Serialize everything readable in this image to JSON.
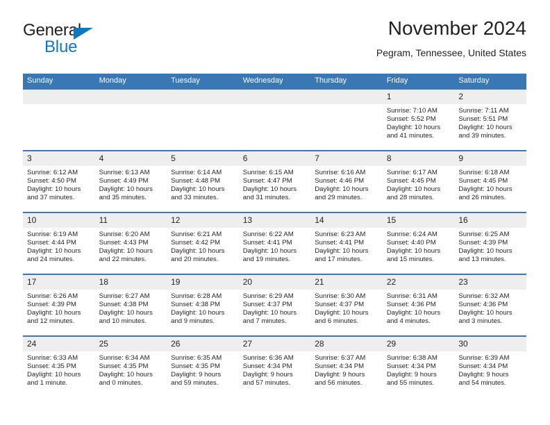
{
  "brand": {
    "name_part1": "General",
    "name_part2": "Blue",
    "accent_color": "#1277bd"
  },
  "header": {
    "title": "November 2024",
    "subtitle": "Pegram, Tennessee, United States"
  },
  "theme": {
    "header_blue": "#3a77b5",
    "daynum_band": "#eeeeee",
    "text": "#231f20"
  },
  "calendar": {
    "weekday_headers": [
      "Sunday",
      "Monday",
      "Tuesday",
      "Wednesday",
      "Thursday",
      "Friday",
      "Saturday"
    ],
    "labels": {
      "sunrise": "Sunrise:",
      "sunset": "Sunset:",
      "daylight": "Daylight:"
    },
    "weeks": [
      [
        {
          "day": "",
          "sunrise": "",
          "sunset": "",
          "daylight_line1": "",
          "daylight_line2": ""
        },
        {
          "day": "",
          "sunrise": "",
          "sunset": "",
          "daylight_line1": "",
          "daylight_line2": ""
        },
        {
          "day": "",
          "sunrise": "",
          "sunset": "",
          "daylight_line1": "",
          "daylight_line2": ""
        },
        {
          "day": "",
          "sunrise": "",
          "sunset": "",
          "daylight_line1": "",
          "daylight_line2": ""
        },
        {
          "day": "",
          "sunrise": "",
          "sunset": "",
          "daylight_line1": "",
          "daylight_line2": ""
        },
        {
          "day": "1",
          "sunrise": "Sunrise: 7:10 AM",
          "sunset": "Sunset: 5:52 PM",
          "daylight_line1": "Daylight: 10 hours",
          "daylight_line2": "and 41 minutes."
        },
        {
          "day": "2",
          "sunrise": "Sunrise: 7:11 AM",
          "sunset": "Sunset: 5:51 PM",
          "daylight_line1": "Daylight: 10 hours",
          "daylight_line2": "and 39 minutes."
        }
      ],
      [
        {
          "day": "3",
          "sunrise": "Sunrise: 6:12 AM",
          "sunset": "Sunset: 4:50 PM",
          "daylight_line1": "Daylight: 10 hours",
          "daylight_line2": "and 37 minutes."
        },
        {
          "day": "4",
          "sunrise": "Sunrise: 6:13 AM",
          "sunset": "Sunset: 4:49 PM",
          "daylight_line1": "Daylight: 10 hours",
          "daylight_line2": "and 35 minutes."
        },
        {
          "day": "5",
          "sunrise": "Sunrise: 6:14 AM",
          "sunset": "Sunset: 4:48 PM",
          "daylight_line1": "Daylight: 10 hours",
          "daylight_line2": "and 33 minutes."
        },
        {
          "day": "6",
          "sunrise": "Sunrise: 6:15 AM",
          "sunset": "Sunset: 4:47 PM",
          "daylight_line1": "Daylight: 10 hours",
          "daylight_line2": "and 31 minutes."
        },
        {
          "day": "7",
          "sunrise": "Sunrise: 6:16 AM",
          "sunset": "Sunset: 4:46 PM",
          "daylight_line1": "Daylight: 10 hours",
          "daylight_line2": "and 29 minutes."
        },
        {
          "day": "8",
          "sunrise": "Sunrise: 6:17 AM",
          "sunset": "Sunset: 4:45 PM",
          "daylight_line1": "Daylight: 10 hours",
          "daylight_line2": "and 28 minutes."
        },
        {
          "day": "9",
          "sunrise": "Sunrise: 6:18 AM",
          "sunset": "Sunset: 4:45 PM",
          "daylight_line1": "Daylight: 10 hours",
          "daylight_line2": "and 26 minutes."
        }
      ],
      [
        {
          "day": "10",
          "sunrise": "Sunrise: 6:19 AM",
          "sunset": "Sunset: 4:44 PM",
          "daylight_line1": "Daylight: 10 hours",
          "daylight_line2": "and 24 minutes."
        },
        {
          "day": "11",
          "sunrise": "Sunrise: 6:20 AM",
          "sunset": "Sunset: 4:43 PM",
          "daylight_line1": "Daylight: 10 hours",
          "daylight_line2": "and 22 minutes."
        },
        {
          "day": "12",
          "sunrise": "Sunrise: 6:21 AM",
          "sunset": "Sunset: 4:42 PM",
          "daylight_line1": "Daylight: 10 hours",
          "daylight_line2": "and 20 minutes."
        },
        {
          "day": "13",
          "sunrise": "Sunrise: 6:22 AM",
          "sunset": "Sunset: 4:41 PM",
          "daylight_line1": "Daylight: 10 hours",
          "daylight_line2": "and 19 minutes."
        },
        {
          "day": "14",
          "sunrise": "Sunrise: 6:23 AM",
          "sunset": "Sunset: 4:41 PM",
          "daylight_line1": "Daylight: 10 hours",
          "daylight_line2": "and 17 minutes."
        },
        {
          "day": "15",
          "sunrise": "Sunrise: 6:24 AM",
          "sunset": "Sunset: 4:40 PM",
          "daylight_line1": "Daylight: 10 hours",
          "daylight_line2": "and 15 minutes."
        },
        {
          "day": "16",
          "sunrise": "Sunrise: 6:25 AM",
          "sunset": "Sunset: 4:39 PM",
          "daylight_line1": "Daylight: 10 hours",
          "daylight_line2": "and 13 minutes."
        }
      ],
      [
        {
          "day": "17",
          "sunrise": "Sunrise: 6:26 AM",
          "sunset": "Sunset: 4:39 PM",
          "daylight_line1": "Daylight: 10 hours",
          "daylight_line2": "and 12 minutes."
        },
        {
          "day": "18",
          "sunrise": "Sunrise: 6:27 AM",
          "sunset": "Sunset: 4:38 PM",
          "daylight_line1": "Daylight: 10 hours",
          "daylight_line2": "and 10 minutes."
        },
        {
          "day": "19",
          "sunrise": "Sunrise: 6:28 AM",
          "sunset": "Sunset: 4:38 PM",
          "daylight_line1": "Daylight: 10 hours",
          "daylight_line2": "and 9 minutes."
        },
        {
          "day": "20",
          "sunrise": "Sunrise: 6:29 AM",
          "sunset": "Sunset: 4:37 PM",
          "daylight_line1": "Daylight: 10 hours",
          "daylight_line2": "and 7 minutes."
        },
        {
          "day": "21",
          "sunrise": "Sunrise: 6:30 AM",
          "sunset": "Sunset: 4:37 PM",
          "daylight_line1": "Daylight: 10 hours",
          "daylight_line2": "and 6 minutes."
        },
        {
          "day": "22",
          "sunrise": "Sunrise: 6:31 AM",
          "sunset": "Sunset: 4:36 PM",
          "daylight_line1": "Daylight: 10 hours",
          "daylight_line2": "and 4 minutes."
        },
        {
          "day": "23",
          "sunrise": "Sunrise: 6:32 AM",
          "sunset": "Sunset: 4:36 PM",
          "daylight_line1": "Daylight: 10 hours",
          "daylight_line2": "and 3 minutes."
        }
      ],
      [
        {
          "day": "24",
          "sunrise": "Sunrise: 6:33 AM",
          "sunset": "Sunset: 4:35 PM",
          "daylight_line1": "Daylight: 10 hours",
          "daylight_line2": "and 1 minute."
        },
        {
          "day": "25",
          "sunrise": "Sunrise: 6:34 AM",
          "sunset": "Sunset: 4:35 PM",
          "daylight_line1": "Daylight: 10 hours",
          "daylight_line2": "and 0 minutes."
        },
        {
          "day": "26",
          "sunrise": "Sunrise: 6:35 AM",
          "sunset": "Sunset: 4:35 PM",
          "daylight_line1": "Daylight: 9 hours",
          "daylight_line2": "and 59 minutes."
        },
        {
          "day": "27",
          "sunrise": "Sunrise: 6:36 AM",
          "sunset": "Sunset: 4:34 PM",
          "daylight_line1": "Daylight: 9 hours",
          "daylight_line2": "and 57 minutes."
        },
        {
          "day": "28",
          "sunrise": "Sunrise: 6:37 AM",
          "sunset": "Sunset: 4:34 PM",
          "daylight_line1": "Daylight: 9 hours",
          "daylight_line2": "and 56 minutes."
        },
        {
          "day": "29",
          "sunrise": "Sunrise: 6:38 AM",
          "sunset": "Sunset: 4:34 PM",
          "daylight_line1": "Daylight: 9 hours",
          "daylight_line2": "and 55 minutes."
        },
        {
          "day": "30",
          "sunrise": "Sunrise: 6:39 AM",
          "sunset": "Sunset: 4:34 PM",
          "daylight_line1": "Daylight: 9 hours",
          "daylight_line2": "and 54 minutes."
        }
      ]
    ]
  }
}
